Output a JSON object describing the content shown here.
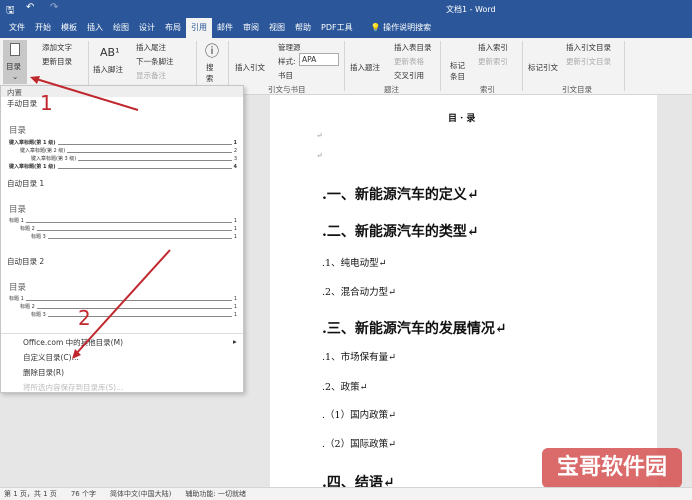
{
  "title": "文档1 - Word",
  "qat": {
    "save": "save-icon",
    "undo": "undo-icon",
    "redo": "redo-icon"
  },
  "tabs": [
    "文件",
    "开始",
    "模板",
    "插入",
    "绘图",
    "设计",
    "布局",
    "引用",
    "邮件",
    "审阅",
    "视图",
    "帮助",
    "PDF工具"
  ],
  "active_tab": "引用",
  "tell_me": "操作说明搜索",
  "ribbon": {
    "toc": "目录",
    "add_text": "添加文字",
    "update_toc": "更新目录",
    "insert_footnote": "插入脚注",
    "insert_endnote": "插入尾注",
    "next_footnote": "下一条脚注",
    "show_notes": "显示备注",
    "search": "搜索",
    "insert_citation": "插入引文",
    "manage_sources": "管理源",
    "style_label": "样式:",
    "style_value": "APA",
    "bibliography": "书目",
    "group_citations": "引文与书目",
    "insert_caption": "插入题注",
    "insert_table_figures": "插入表目录",
    "update_table": "更新表格",
    "cross_ref": "交叉引用",
    "group_captions": "题注",
    "mark_entry": "标记条目",
    "insert_index": "插入索引",
    "update_index": "更新索引",
    "group_index": "索引",
    "mark_citation": "标记引文",
    "insert_toa": "插入引文目录",
    "update_toa": "更新引文目录",
    "group_toa": "引文目录"
  },
  "menu": {
    "builtin": "内置",
    "manual": {
      "name": "手动目录",
      "heading": "目录",
      "lines": [
        {
          "t": "键入章标题(第 1 级)",
          "p": "1"
        },
        {
          "t": "键入章标题(第 2 级)",
          "p": "2"
        },
        {
          "t": "键入章标题(第 3 级)",
          "p": "3"
        },
        {
          "t": "键入章标题(第 1 级)",
          "p": "4"
        }
      ]
    },
    "auto1": {
      "name": "自动目录 1",
      "heading": "目录",
      "lines": [
        {
          "t": "标题 1",
          "p": "1"
        },
        {
          "t": "标题 2",
          "p": "1"
        },
        {
          "t": "标题 3",
          "p": "1"
        }
      ]
    },
    "auto2": {
      "name": "自动目录 2",
      "heading": "目录",
      "lines": [
        {
          "t": "标题 1",
          "p": "1"
        },
        {
          "t": "标题 2",
          "p": "1"
        },
        {
          "t": "标题 3",
          "p": "1"
        }
      ]
    },
    "office_more": "Office.com 中的其他目录(M)",
    "custom": "自定义目录(C)...",
    "remove": "删除目录(R)",
    "save_sel": "将所选内容保存到目录库(S)..."
  },
  "annotations": {
    "one": "1",
    "two": "2",
    "arrow_color": "#c0282d"
  },
  "document": {
    "toc_title": "目 · 录",
    "para1": "↵",
    "para2": "↵",
    "lines": [
      {
        "t": ".一、新能源汽车的定义↵",
        "lvl": 1
      },
      {
        "t": ".二、新能源汽车的类型↵",
        "lvl": 1
      },
      {
        "t": ".1、纯电动型↵",
        "lvl": 2
      },
      {
        "t": ".2、混合动力型↵",
        "lvl": 2
      },
      {
        "t": ".三、新能源汽车的发展情况↵",
        "lvl": 1
      },
      {
        "t": ".1、市场保有量↵",
        "lvl": 2
      },
      {
        "t": ".2、政策↵",
        "lvl": 2
      },
      {
        "t": ".（1）国内政策↵",
        "lvl": 2
      },
      {
        "t": ".（2）国际政策↵",
        "lvl": 2
      },
      {
        "t": ".四、结语↵",
        "lvl": 1
      }
    ]
  },
  "status": {
    "page": "第 1 页，共 1 页",
    "words": "76 个字",
    "lang": "简体中文(中国大陆)",
    "access": "辅助功能: 一切就绪"
  },
  "watermark": "宝哥软件园"
}
